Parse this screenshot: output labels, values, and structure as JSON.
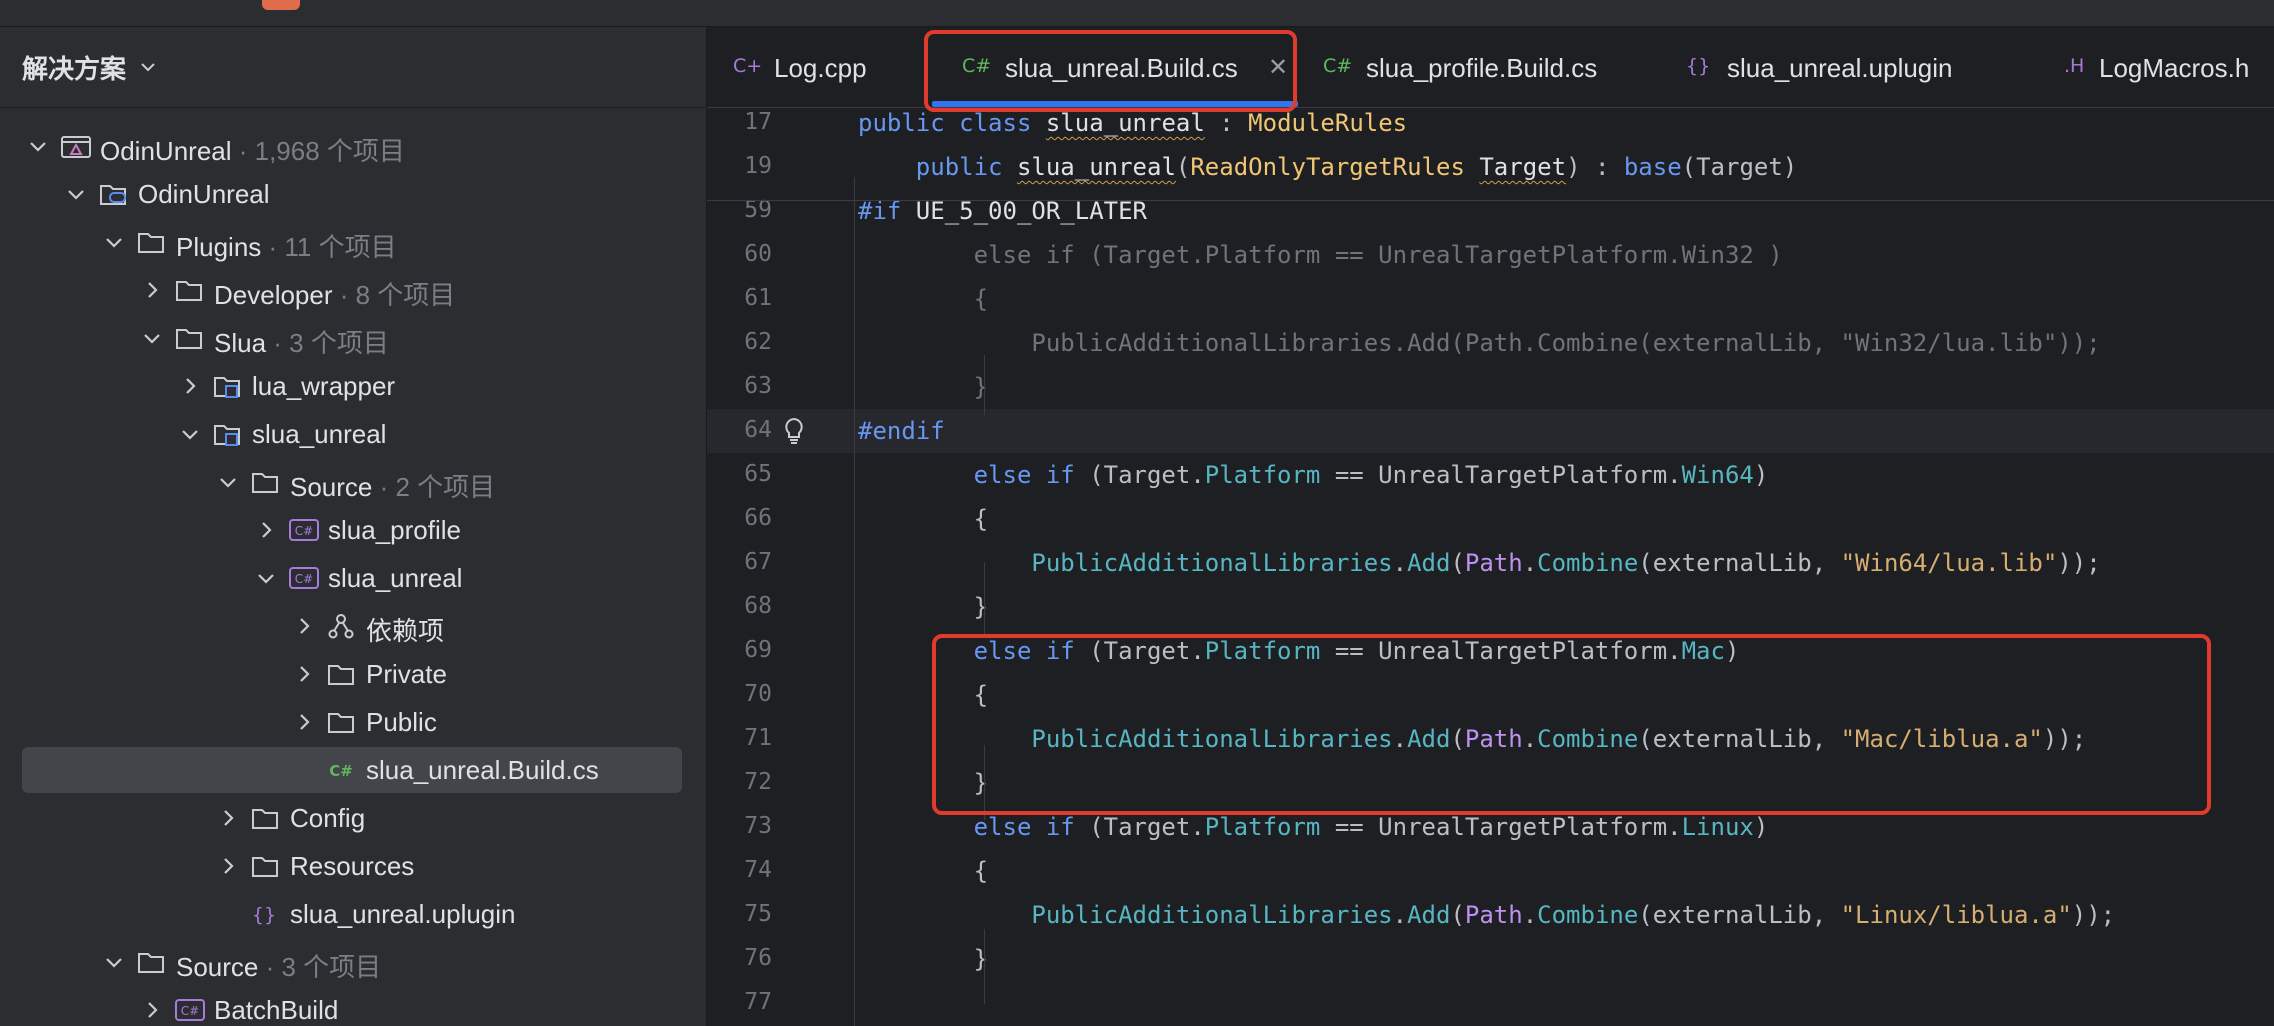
{
  "sidebar": {
    "title": "解决方案",
    "tree": [
      {
        "label": "OdinUnreal",
        "meta": " · 1,968 个项目",
        "icon": "solution-icon",
        "expanded": true
      },
      {
        "label": "OdinUnreal",
        "meta": "",
        "icon": "gamepad-project-icon",
        "expanded": true
      },
      {
        "label": "Plugins",
        "meta": " · 11 个项目",
        "icon": "folder-icon",
        "expanded": true
      },
      {
        "label": "Developer",
        "meta": " · 8 个项目",
        "icon": "folder-icon",
        "expanded": false
      },
      {
        "label": "Slua",
        "meta": " · 3 个项目",
        "icon": "folder-icon",
        "expanded": true
      },
      {
        "label": "lua_wrapper",
        "meta": "",
        "icon": "module-folder-icon",
        "expanded": false
      },
      {
        "label": "slua_unreal",
        "meta": "",
        "icon": "module-folder-icon",
        "expanded": true
      },
      {
        "label": "Source",
        "meta": " · 2 个项目",
        "icon": "folder-icon",
        "expanded": true
      },
      {
        "label": "slua_profile",
        "meta": "",
        "icon": "csharp-project-icon",
        "expanded": false
      },
      {
        "label": "slua_unreal",
        "meta": "",
        "icon": "csharp-project-icon",
        "expanded": true
      },
      {
        "label": "依赖项",
        "meta": "",
        "icon": "dependencies-icon",
        "expanded": false
      },
      {
        "label": "Private",
        "meta": "",
        "icon": "folder-icon",
        "expanded": false
      },
      {
        "label": "Public",
        "meta": "",
        "icon": "folder-icon",
        "expanded": false
      },
      {
        "label": "slua_unreal.Build.cs",
        "meta": "",
        "icon": "csharp-file-icon",
        "expanded": null,
        "selected": true
      },
      {
        "label": "Config",
        "meta": "",
        "icon": "folder-icon",
        "expanded": false
      },
      {
        "label": "Resources",
        "meta": "",
        "icon": "folder-icon",
        "expanded": false
      },
      {
        "label": "slua_unreal.uplugin",
        "meta": "",
        "icon": "json-braces-icon",
        "expanded": null
      },
      {
        "label": "Source",
        "meta": " · 3 个项目",
        "icon": "folder-icon",
        "expanded": true
      },
      {
        "label": "BatchBuild",
        "meta": "",
        "icon": "csharp-project-icon",
        "expanded": false
      }
    ]
  },
  "tabs": [
    {
      "label": "Log.cpp",
      "icon_text": "C+",
      "icon_color": "#a77bdb",
      "active": false
    },
    {
      "label": "slua_unreal.Build.cs",
      "icon_text": "C#",
      "icon_color": "#5fb85f",
      "active": true,
      "close": "✕"
    },
    {
      "label": "slua_profile.Build.cs",
      "icon_text": "C#",
      "icon_color": "#5fb85f",
      "active": false
    },
    {
      "label": "slua_unreal.uplugin",
      "icon_text": "{}",
      "icon_color": "#a77bdb",
      "active": false
    },
    {
      "label": "LogMacros.h",
      "icon_text": ".H",
      "icon_color": "#a77bdb",
      "active": false
    }
  ],
  "code": {
    "line_numbers": [
      "17",
      "19",
      "59",
      "60",
      "61",
      "62",
      "63",
      "64",
      "65",
      "66",
      "67",
      "68",
      "69",
      "70",
      "71",
      "72",
      "73",
      "74",
      "75",
      "76",
      "77"
    ],
    "current_line": "64"
  },
  "colors": {
    "highlight": "#e03b2c",
    "accent": "#3574f0"
  }
}
